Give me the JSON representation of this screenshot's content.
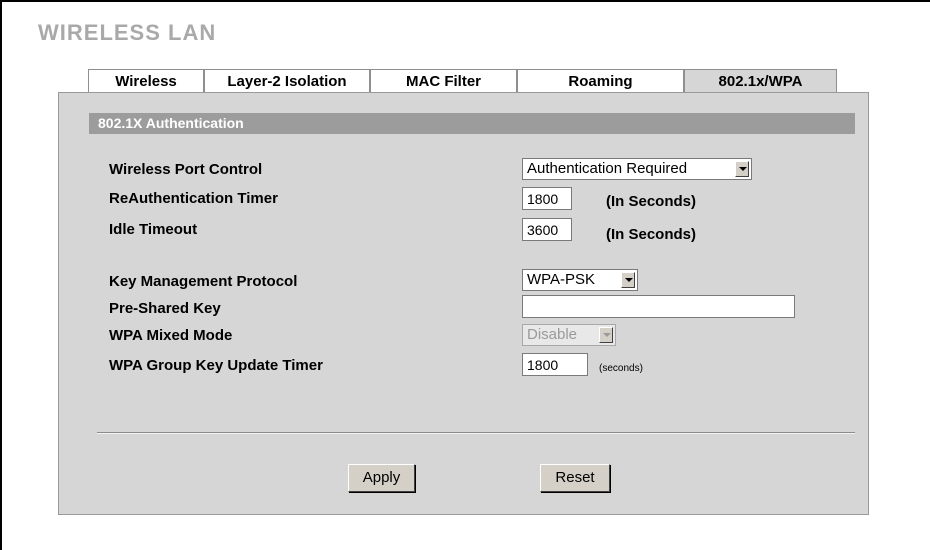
{
  "page": {
    "title": "WIRELESS LAN"
  },
  "tabs": [
    {
      "label": "Wireless",
      "active": false
    },
    {
      "label": "Layer-2 Isolation",
      "active": false
    },
    {
      "label": "MAC Filter",
      "active": false
    },
    {
      "label": "Roaming",
      "active": false
    },
    {
      "label": "802.1x/WPA",
      "active": true
    }
  ],
  "section": {
    "title": "802.1X Authentication"
  },
  "fields": {
    "port_control": {
      "label": "Wireless Port Control",
      "value": "Authentication Required"
    },
    "reauth_timer": {
      "label": "ReAuthentication Timer",
      "value": "1800",
      "unit": "(In Seconds)"
    },
    "idle_timeout": {
      "label": "Idle Timeout",
      "value": "3600",
      "unit": "(In Seconds)"
    },
    "key_mgmt": {
      "label": "Key Management Protocol",
      "value": "WPA-PSK"
    },
    "psk": {
      "label": "Pre-Shared Key",
      "value": ""
    },
    "mixed_mode": {
      "label": "WPA Mixed Mode",
      "value": "Disable",
      "disabled": true
    },
    "group_key_timer": {
      "label": "WPA Group Key Update Timer",
      "value": "1800",
      "unit": "(seconds)"
    }
  },
  "buttons": {
    "apply": "Apply",
    "reset": "Reset"
  }
}
